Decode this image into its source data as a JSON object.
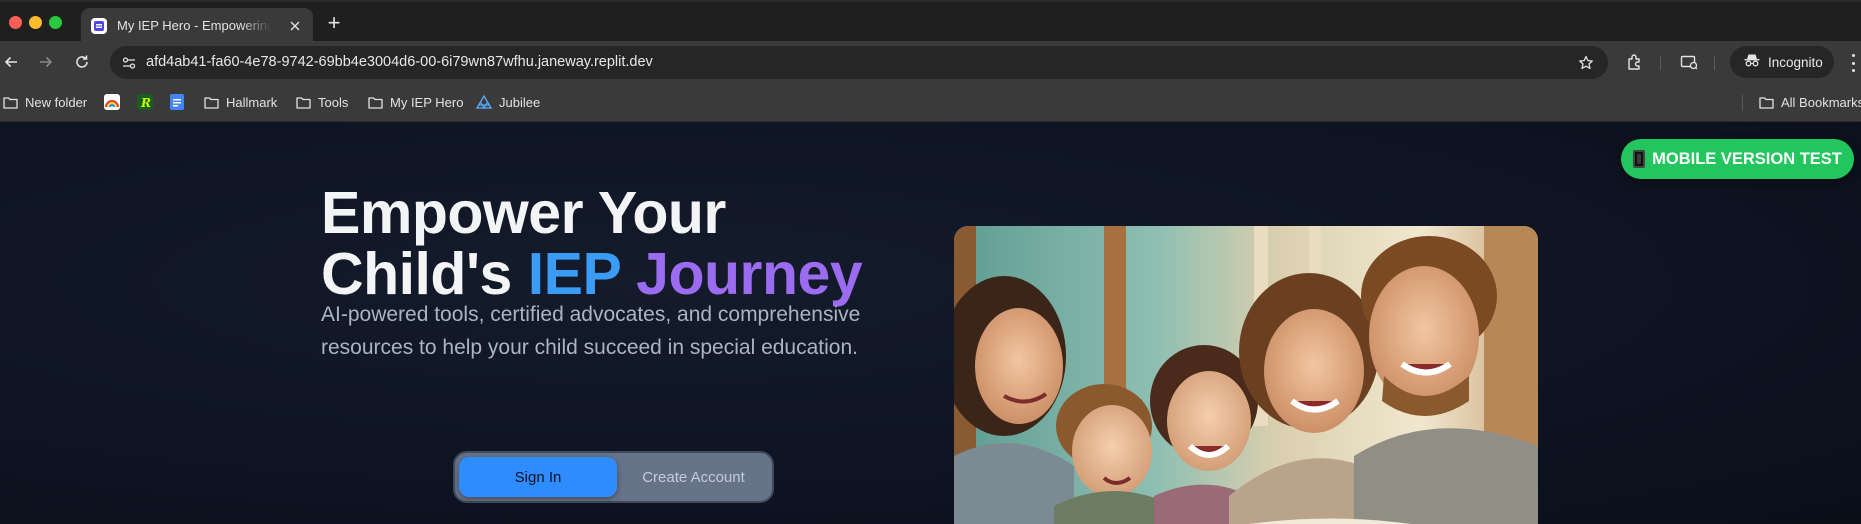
{
  "browser": {
    "tab": {
      "title": "My IEP Hero - Empowering Parents",
      "favicon": "iep-hero-logo-icon"
    },
    "new_tab_glyph": "+",
    "address_bar": {
      "url": "afd4ab41-fa60-4e78-9742-69bb4e3004d6-00-6i79wn87wfhu.janeway.replit.dev"
    },
    "profile": {
      "label": "Incognito"
    },
    "bookmarks": [
      {
        "label": "New folder",
        "icon": "folder-icon"
      },
      {
        "label": "",
        "icon": "rainbow-app-icon"
      },
      {
        "label": "",
        "icon": "r-app-icon"
      },
      {
        "label": "",
        "icon": "google-docs-icon"
      },
      {
        "label": "Hallmark",
        "icon": "folder-icon"
      },
      {
        "label": "Tools",
        "icon": "folder-icon"
      },
      {
        "label": "My IEP Hero",
        "icon": "folder-icon"
      },
      {
        "label": "Jubilee",
        "icon": "jubilee-icon"
      }
    ],
    "all_bookmarks": {
      "label": "All Bookmarks",
      "icon": "folder-icon"
    }
  },
  "page": {
    "mobile_test_button": "MOBILE VERSION TEST",
    "hero": {
      "headline_line1": "Empower Your",
      "headline_line2_start": "Child's ",
      "headline_highlight_blue": "IEP",
      "headline_highlight_purple": "Journey",
      "subtext": "AI-powered tools, certified advocates, and comprehensive resources to help your child succeed in special education."
    },
    "auth": {
      "sign_in_label": "Sign In",
      "create_account_label": "Create Account",
      "active": "sign-in"
    },
    "image": {
      "subject": "family-photo"
    }
  },
  "colors": {
    "accent_green": "#22c55e",
    "accent_blue": "#3b9cf6",
    "accent_purple": "#9b6bf0",
    "sign_in_blue": "#2f8cff",
    "page_background": "#0e1422"
  }
}
